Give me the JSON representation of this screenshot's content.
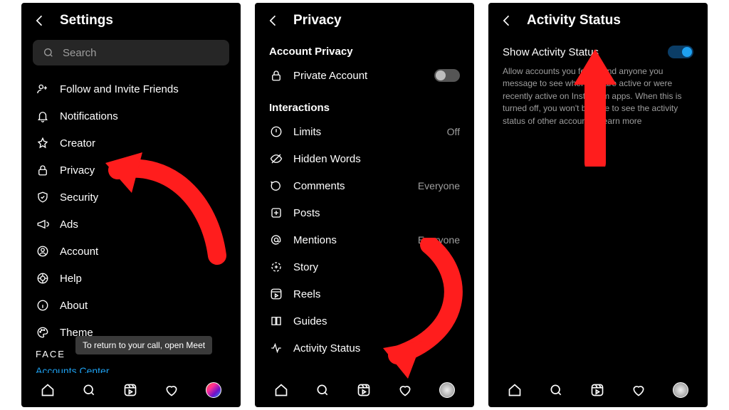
{
  "screen1": {
    "title": "Settings",
    "search_placeholder": "Search",
    "items": [
      {
        "label": "Follow and Invite Friends"
      },
      {
        "label": "Notifications"
      },
      {
        "label": "Creator"
      },
      {
        "label": "Privacy"
      },
      {
        "label": "Security"
      },
      {
        "label": "Ads"
      },
      {
        "label": "Account"
      },
      {
        "label": "Help"
      },
      {
        "label": "About"
      },
      {
        "label": "Theme"
      }
    ],
    "footer_brand": "FACE",
    "accounts_center": "Accounts Center",
    "toast": "To return to your call, open Meet"
  },
  "screen2": {
    "title": "Privacy",
    "section_account": "Account Privacy",
    "private_account": "Private Account",
    "section_interactions": "Interactions",
    "items": [
      {
        "label": "Limits",
        "value": "Off"
      },
      {
        "label": "Hidden Words"
      },
      {
        "label": "Comments",
        "value": "Everyone"
      },
      {
        "label": "Posts"
      },
      {
        "label": "Mentions",
        "value": "Everyone"
      },
      {
        "label": "Story"
      },
      {
        "label": "Reels"
      },
      {
        "label": "Guides"
      },
      {
        "label": "Activity Status"
      }
    ]
  },
  "screen3": {
    "title": "Activity Status",
    "toggle_label": "Show Activity Status",
    "toggle_on": true,
    "description": "Allow accounts you follow and anyone you message to see when you are active or were recently active on Instagram apps. When this is turned off, you won't be able to see the activity status of other accounts. Learn more"
  }
}
